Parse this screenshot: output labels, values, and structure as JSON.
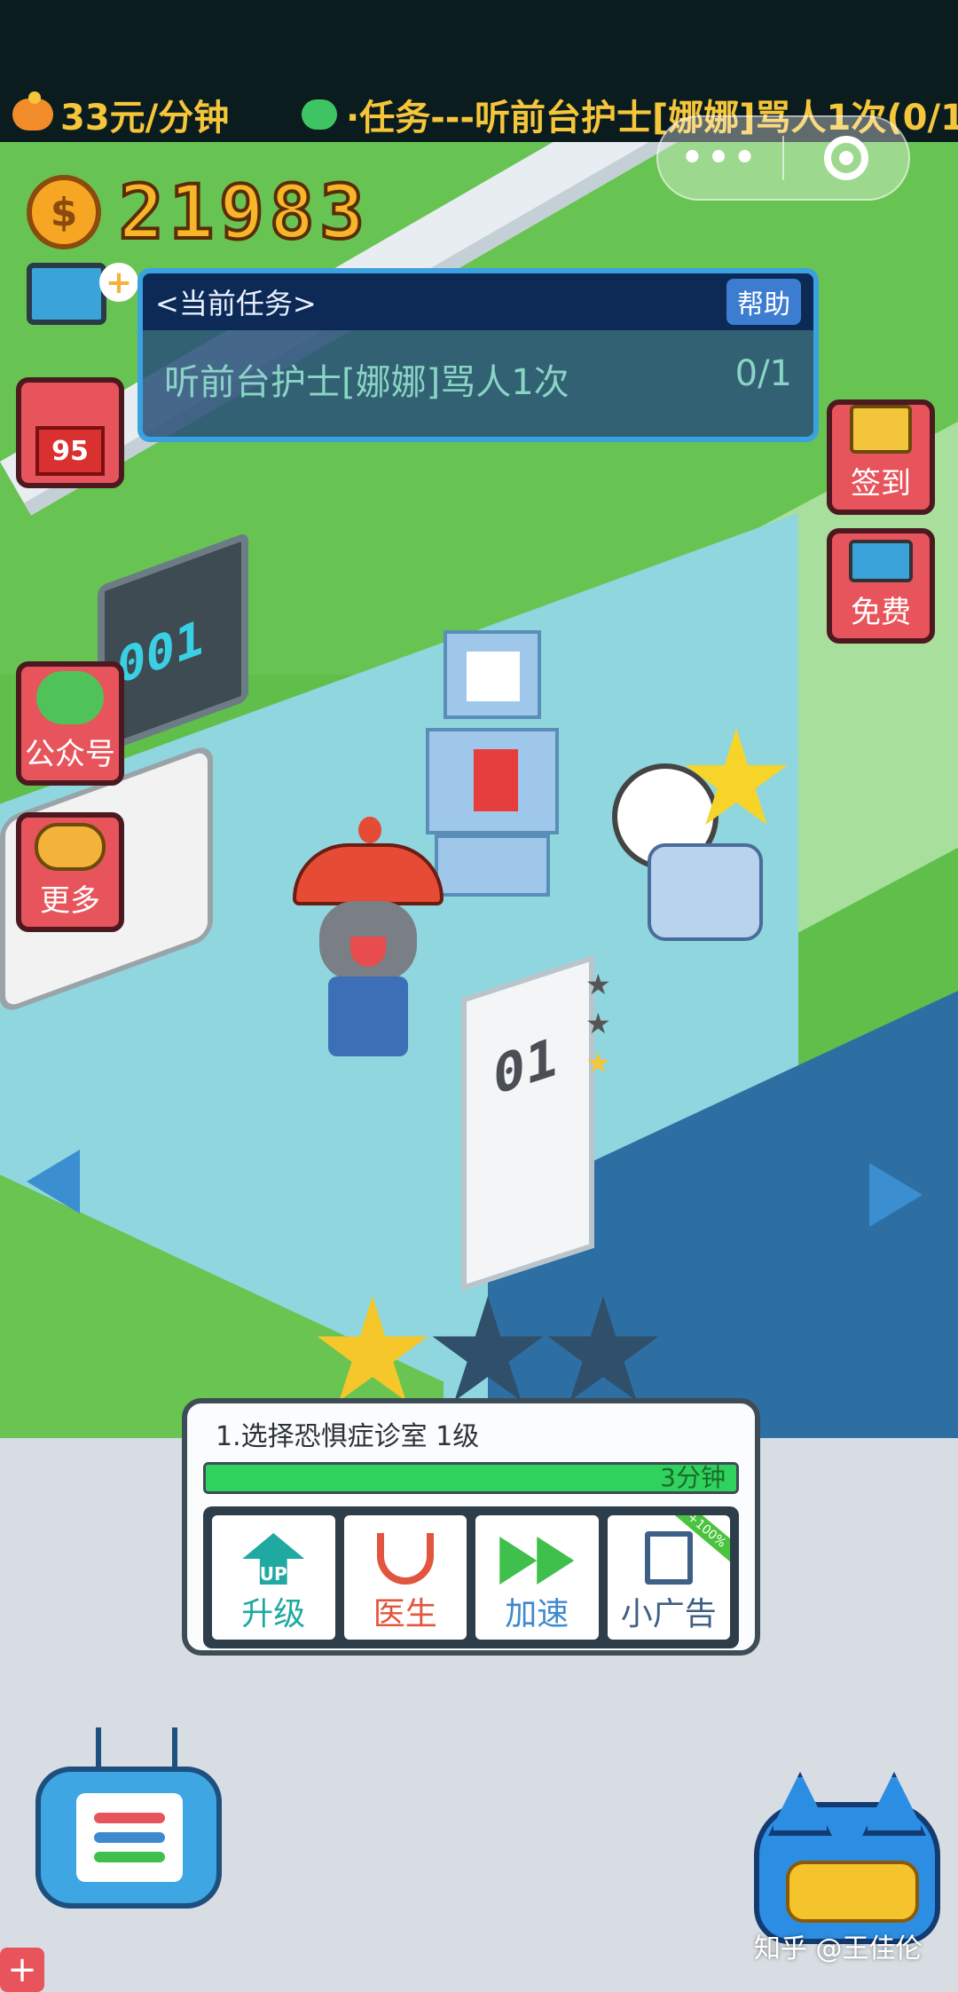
{
  "topbar": {
    "income_rate": "33元/分钟",
    "ticker_text": "·任务---听前台护士[娜娜]骂人1次(0/1"
  },
  "capsule": {
    "more_label": "•••",
    "close_icon": "target-close-icon"
  },
  "coins": {
    "amount": "21983"
  },
  "task": {
    "header": "<当前任务>",
    "help_label": "帮助",
    "description": "听前台护士[娜娜]骂人1次",
    "progress": "0/1"
  },
  "left_buttons": {
    "level_badge": "95",
    "wechat_label": "公众号",
    "more_label": "更多"
  },
  "right_buttons": {
    "signin_label": "签到",
    "free_label": "免费"
  },
  "room": {
    "monitor_number": "001",
    "door_number": "01",
    "door_stars": [
      "★",
      "★",
      "★"
    ],
    "door_stars_gold": 1
  },
  "popup": {
    "title": "1.选择恐惧症诊室 1级",
    "progress_label": "3分钟",
    "progress_fraction": 1.0,
    "stars_earned": 1,
    "stars_total": 3,
    "actions": {
      "upgrade": "升级",
      "doctor": "医生",
      "speedup": "加速",
      "ad": "小广告",
      "up_badge": "UP",
      "ad_ribbon": "+100%"
    }
  },
  "watermark": "知乎 @王佳伦",
  "colors": {
    "gold": "#f7b52a",
    "accent_blue": "#3aa2e0",
    "button_red": "#e8545b",
    "progress_green": "#2fd25d"
  }
}
